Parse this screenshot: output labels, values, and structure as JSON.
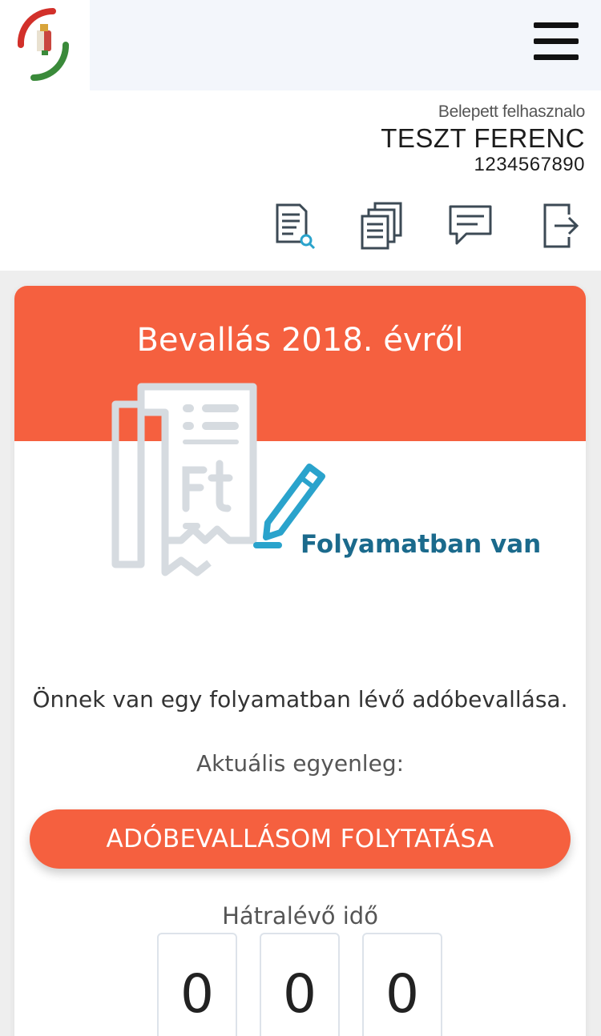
{
  "header": {
    "logo_icon": "hungarian-coat-of-arms-logo",
    "menu_icon": "hamburger-menu-icon"
  },
  "user": {
    "label": "Belepett felhasznalo",
    "name": "TESZT FERENC",
    "id": "1234567890"
  },
  "toolbar": {
    "icons": [
      "document-search-icon",
      "documents-stack-icon",
      "message-icon",
      "logout-icon"
    ]
  },
  "card": {
    "title": "Bevallás 2018. évről",
    "status": "Folyamatban van",
    "info": "Önnek van egy folyamatban lévő adóbevallása.",
    "balance_label": "Aktuális egyenleg:",
    "continue_button": "ADÓBEVALLÁSOM FOLYTATÁSA",
    "time_label": "Hátralévő idő",
    "timer_digits": [
      "0",
      "0",
      "0"
    ]
  },
  "colors": {
    "accent": "#f5603f",
    "status": "#1b6a8c",
    "pencil": "#2aa3cc",
    "topbar": "#f3f6fb"
  }
}
